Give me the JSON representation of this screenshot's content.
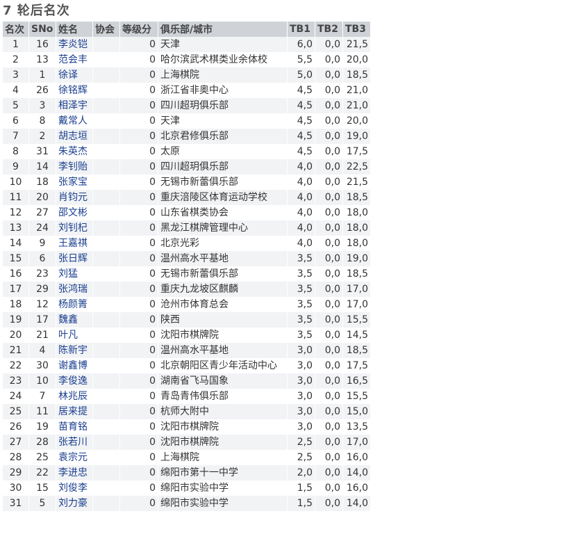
{
  "title": "7 轮后名次",
  "headers": {
    "rank": "名次",
    "sno": "SNo",
    "name": "姓名",
    "fed": "协会",
    "rating": "等级分",
    "club": "俱乐部/城市",
    "tb1": "TB1",
    "tb2": "TB2",
    "tb3": "TB3"
  },
  "rows": [
    {
      "rank": "1",
      "sno": "16",
      "name": "李炎铠",
      "fed": "",
      "rating": "0",
      "club": "天津",
      "tb1": "6,0",
      "tb2": "0,0",
      "tb3": "21,5"
    },
    {
      "rank": "2",
      "sno": "13",
      "name": "范会丰",
      "fed": "",
      "rating": "0",
      "club": "哈尔滨武术棋类业余体校",
      "tb1": "5,5",
      "tb2": "0,0",
      "tb3": "20,0"
    },
    {
      "rank": "3",
      "sno": "1",
      "name": "徐译",
      "fed": "",
      "rating": "0",
      "club": "上海棋院",
      "tb1": "5,0",
      "tb2": "0,0",
      "tb3": "18,5"
    },
    {
      "rank": "4",
      "sno": "26",
      "name": "徐铭辉",
      "fed": "",
      "rating": "0",
      "club": "浙江省非奥中心",
      "tb1": "4,5",
      "tb2": "0,0",
      "tb3": "21,0"
    },
    {
      "rank": "5",
      "sno": "3",
      "name": "相泽宇",
      "fed": "",
      "rating": "0",
      "club": "四川超玥俱乐部",
      "tb1": "4,5",
      "tb2": "0,0",
      "tb3": "21,0"
    },
    {
      "rank": "6",
      "sno": "8",
      "name": "戴常人",
      "fed": "",
      "rating": "0",
      "club": "天津",
      "tb1": "4,5",
      "tb2": "0,0",
      "tb3": "20,0"
    },
    {
      "rank": "7",
      "sno": "2",
      "name": "胡志垣",
      "fed": "",
      "rating": "0",
      "club": "北京君修俱乐部",
      "tb1": "4,5",
      "tb2": "0,0",
      "tb3": "19,0"
    },
    {
      "rank": "8",
      "sno": "31",
      "name": "朱英杰",
      "fed": "",
      "rating": "0",
      "club": "太原",
      "tb1": "4,5",
      "tb2": "0,0",
      "tb3": "17,5"
    },
    {
      "rank": "9",
      "sno": "14",
      "name": "李钊贻",
      "fed": "",
      "rating": "0",
      "club": "四川超玥俱乐部",
      "tb1": "4,0",
      "tb2": "0,0",
      "tb3": "22,5"
    },
    {
      "rank": "10",
      "sno": "18",
      "name": "张家宝",
      "fed": "",
      "rating": "0",
      "club": "无锡市新蕾俱乐部",
      "tb1": "4,0",
      "tb2": "0,0",
      "tb3": "21,5"
    },
    {
      "rank": "11",
      "sno": "20",
      "name": "肖钧元",
      "fed": "",
      "rating": "0",
      "club": "重庆涪陵区体育运动学校",
      "tb1": "4,0",
      "tb2": "0,0",
      "tb3": "18,5"
    },
    {
      "rank": "12",
      "sno": "27",
      "name": "邵文彬",
      "fed": "",
      "rating": "0",
      "club": "山东省棋类协会",
      "tb1": "4,0",
      "tb2": "0,0",
      "tb3": "18,0"
    },
    {
      "rank": "13",
      "sno": "24",
      "name": "刘钊杞",
      "fed": "",
      "rating": "0",
      "club": "黑龙江棋牌管理中心",
      "tb1": "4,0",
      "tb2": "0,0",
      "tb3": "18,0"
    },
    {
      "rank": "14",
      "sno": "9",
      "name": "王嘉祺",
      "fed": "",
      "rating": "0",
      "club": "北京光彩",
      "tb1": "4,0",
      "tb2": "0,0",
      "tb3": "18,0"
    },
    {
      "rank": "15",
      "sno": "6",
      "name": "张日辉",
      "fed": "",
      "rating": "0",
      "club": "温州高水平基地",
      "tb1": "3,5",
      "tb2": "0,0",
      "tb3": "19,0"
    },
    {
      "rank": "16",
      "sno": "23",
      "name": "刘猛",
      "fed": "",
      "rating": "0",
      "club": "无锡市新蕾俱乐部",
      "tb1": "3,5",
      "tb2": "0,0",
      "tb3": "18,5"
    },
    {
      "rank": "17",
      "sno": "29",
      "name": "张鸿瑞",
      "fed": "",
      "rating": "0",
      "club": "重庆九龙坡区麒麟",
      "tb1": "3,5",
      "tb2": "0,0",
      "tb3": "17,0"
    },
    {
      "rank": "18",
      "sno": "12",
      "name": "杨颜箐",
      "fed": "",
      "rating": "0",
      "club": "沧州市体育总会",
      "tb1": "3,5",
      "tb2": "0,0",
      "tb3": "17,0"
    },
    {
      "rank": "19",
      "sno": "17",
      "name": "魏鑫",
      "fed": "",
      "rating": "0",
      "club": "陕西",
      "tb1": "3,5",
      "tb2": "0,0",
      "tb3": "15,5"
    },
    {
      "rank": "20",
      "sno": "21",
      "name": "叶凡",
      "fed": "",
      "rating": "0",
      "club": "沈阳市棋牌院",
      "tb1": "3,5",
      "tb2": "0,0",
      "tb3": "14,5"
    },
    {
      "rank": "21",
      "sno": "4",
      "name": "陈新宇",
      "fed": "",
      "rating": "0",
      "club": "温州高水平基地",
      "tb1": "3,0",
      "tb2": "0,0",
      "tb3": "18,5"
    },
    {
      "rank": "22",
      "sno": "30",
      "name": "谢鑫博",
      "fed": "",
      "rating": "0",
      "club": "北京朝阳区青少年活动中心",
      "tb1": "3,0",
      "tb2": "0,0",
      "tb3": "17,5"
    },
    {
      "rank": "23",
      "sno": "10",
      "name": "李俊逸",
      "fed": "",
      "rating": "0",
      "club": "湖南省飞马国象",
      "tb1": "3,0",
      "tb2": "0,0",
      "tb3": "16,5"
    },
    {
      "rank": "24",
      "sno": "7",
      "name": "林兆辰",
      "fed": "",
      "rating": "0",
      "club": "青岛青伟俱乐部",
      "tb1": "3,0",
      "tb2": "0,0",
      "tb3": "15,5"
    },
    {
      "rank": "25",
      "sno": "11",
      "name": "居来提",
      "fed": "",
      "rating": "0",
      "club": "杭师大附中",
      "tb1": "3,0",
      "tb2": "0,0",
      "tb3": "15,0"
    },
    {
      "rank": "26",
      "sno": "19",
      "name": "苗育铭",
      "fed": "",
      "rating": "0",
      "club": "沈阳市棋牌院",
      "tb1": "3,0",
      "tb2": "0,0",
      "tb3": "13,5"
    },
    {
      "rank": "27",
      "sno": "28",
      "name": "张若川",
      "fed": "",
      "rating": "0",
      "club": "沈阳市棋牌院",
      "tb1": "2,5",
      "tb2": "0,0",
      "tb3": "17,0"
    },
    {
      "rank": "28",
      "sno": "25",
      "name": "袁宗元",
      "fed": "",
      "rating": "0",
      "club": "上海棋院",
      "tb1": "2,5",
      "tb2": "0,0",
      "tb3": "16,0"
    },
    {
      "rank": "29",
      "sno": "22",
      "name": "李进忠",
      "fed": "",
      "rating": "0",
      "club": "绵阳市第十一中学",
      "tb1": "2,0",
      "tb2": "0,0",
      "tb3": "14,0"
    },
    {
      "rank": "30",
      "sno": "15",
      "name": "刘俊李",
      "fed": "",
      "rating": "0",
      "club": "绵阳市实验中学",
      "tb1": "1,5",
      "tb2": "0,0",
      "tb3": "16,0"
    },
    {
      "rank": "31",
      "sno": "5",
      "name": "刘力豪",
      "fed": "",
      "rating": "0",
      "club": "绵阳市实验中学",
      "tb1": "1,5",
      "tb2": "0,0",
      "tb3": "14,0"
    }
  ]
}
